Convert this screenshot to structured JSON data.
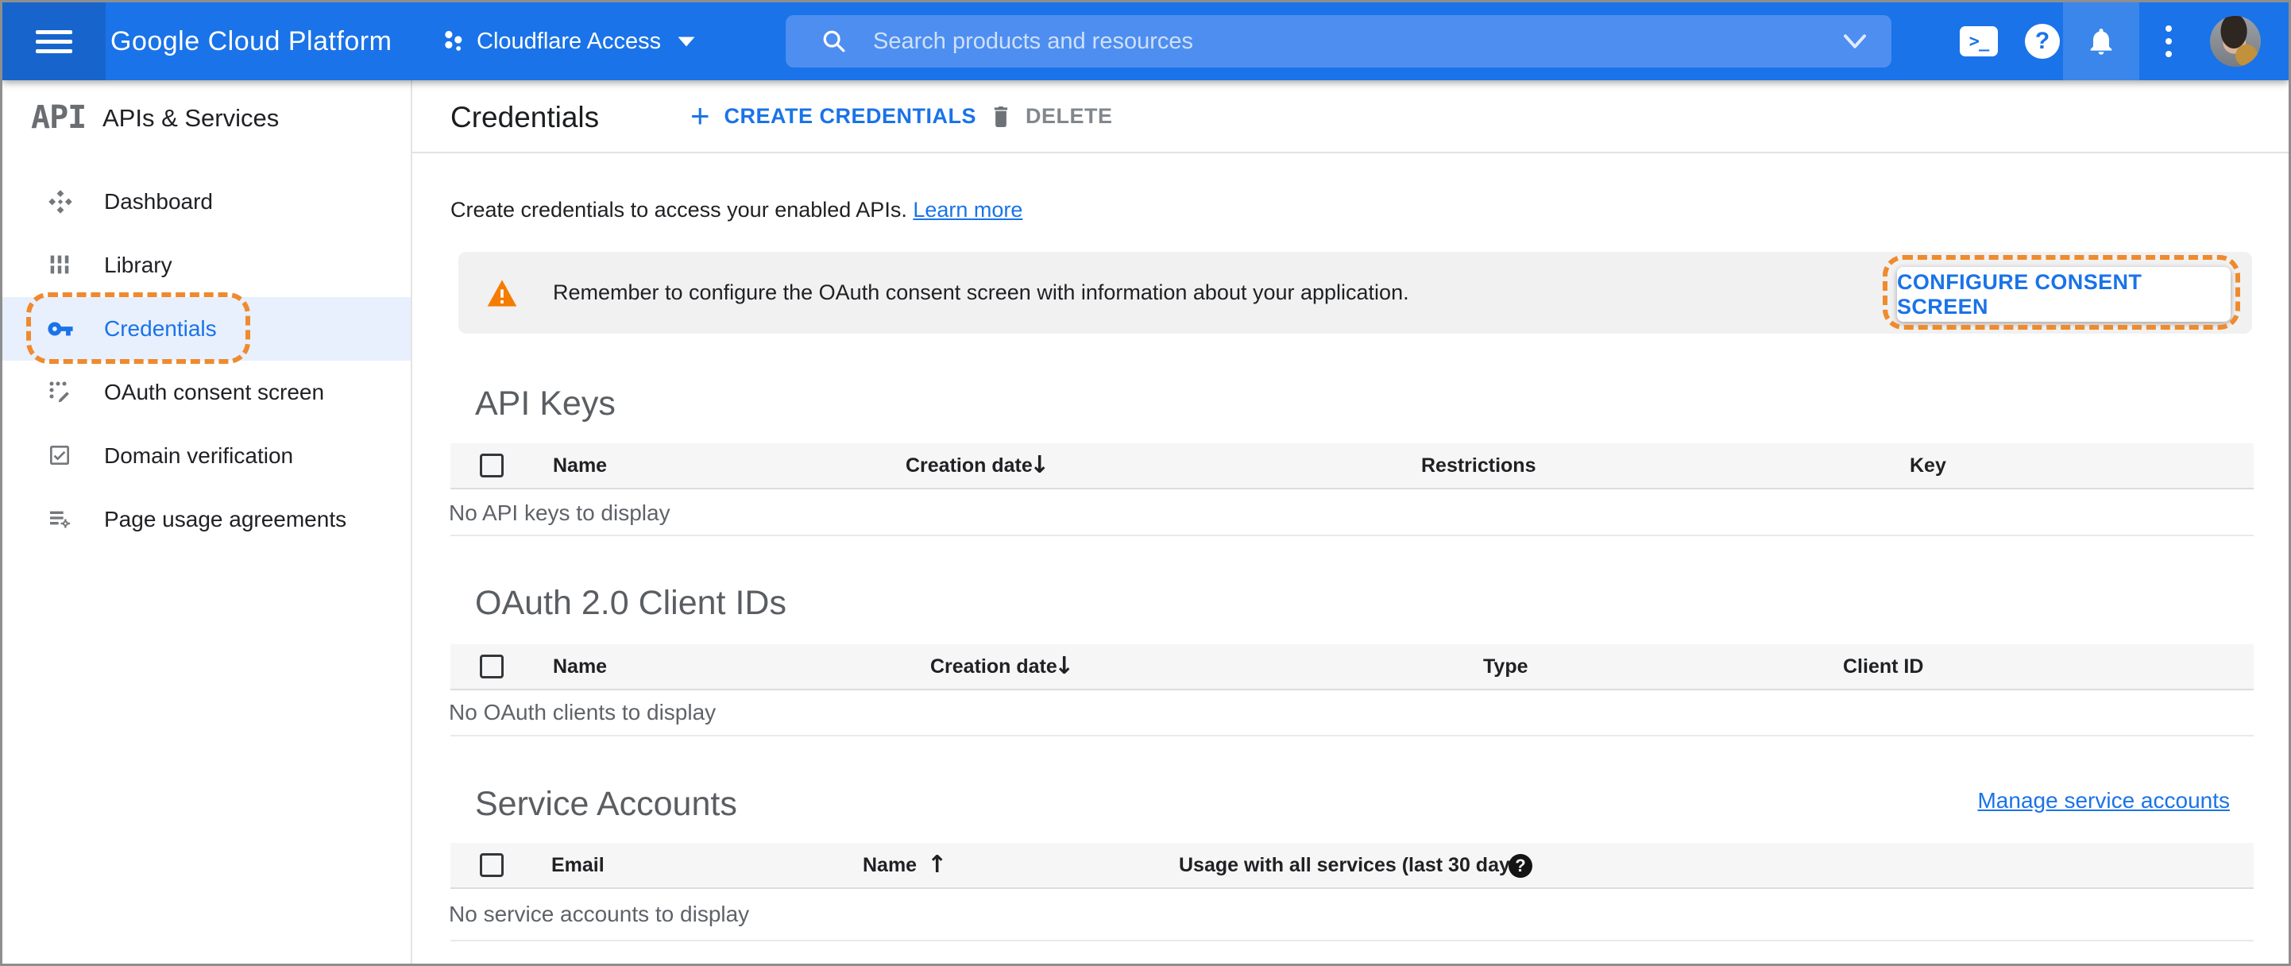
{
  "topbar": {
    "brand": "Google Cloud Platform",
    "project": "Cloudflare Access",
    "search_placeholder": "Search products and resources"
  },
  "sidebar": {
    "logo": "API",
    "title": "APIs & Services",
    "items": [
      {
        "label": "Dashboard",
        "active": false
      },
      {
        "label": "Library",
        "active": false
      },
      {
        "label": "Credentials",
        "active": true
      },
      {
        "label": "OAuth consent screen",
        "active": false
      },
      {
        "label": "Domain verification",
        "active": false
      },
      {
        "label": "Page usage agreements",
        "active": false
      }
    ]
  },
  "toolbar": {
    "title": "Credentials",
    "create_label": "CREATE CREDENTIALS",
    "delete_label": "DELETE"
  },
  "content": {
    "intro": "Create credentials to access your enabled APIs.",
    "learn_more": "Learn more",
    "banner": {
      "message": "Remember to configure the OAuth consent screen with information about your application.",
      "action": "CONFIGURE CONSENT SCREEN"
    },
    "api_keys": {
      "title": "API Keys",
      "columns": {
        "name": "Name",
        "creation_date": "Creation date",
        "restrictions": "Restrictions",
        "key": "Key"
      },
      "sort_arrow": "↓",
      "empty": "No API keys to display"
    },
    "oauth_clients": {
      "title": "OAuth 2.0 Client IDs",
      "columns": {
        "name": "Name",
        "creation_date": "Creation date",
        "type": "Type",
        "client_id": "Client ID"
      },
      "sort_arrow": "↓",
      "empty": "No OAuth clients to display"
    },
    "service_accounts": {
      "title": "Service Accounts",
      "manage_link": "Manage service accounts",
      "columns": {
        "email": "Email",
        "name": "Name",
        "usage": "Usage with all services (last 30 days)"
      },
      "sort_arrow": "↑",
      "empty": "No service accounts to display"
    }
  },
  "colors": {
    "topbar_blue": "#1a73e8",
    "topbar_dark_blue": "#1765cc",
    "accent_blue": "#1a73e8",
    "active_item_bg": "#e8f0fe",
    "annotation_orange": "#ef8a2e",
    "warning_orange": "#f57c00",
    "banner_bg": "#f1f1f1",
    "table_header_bg": "#f6f6f6"
  }
}
